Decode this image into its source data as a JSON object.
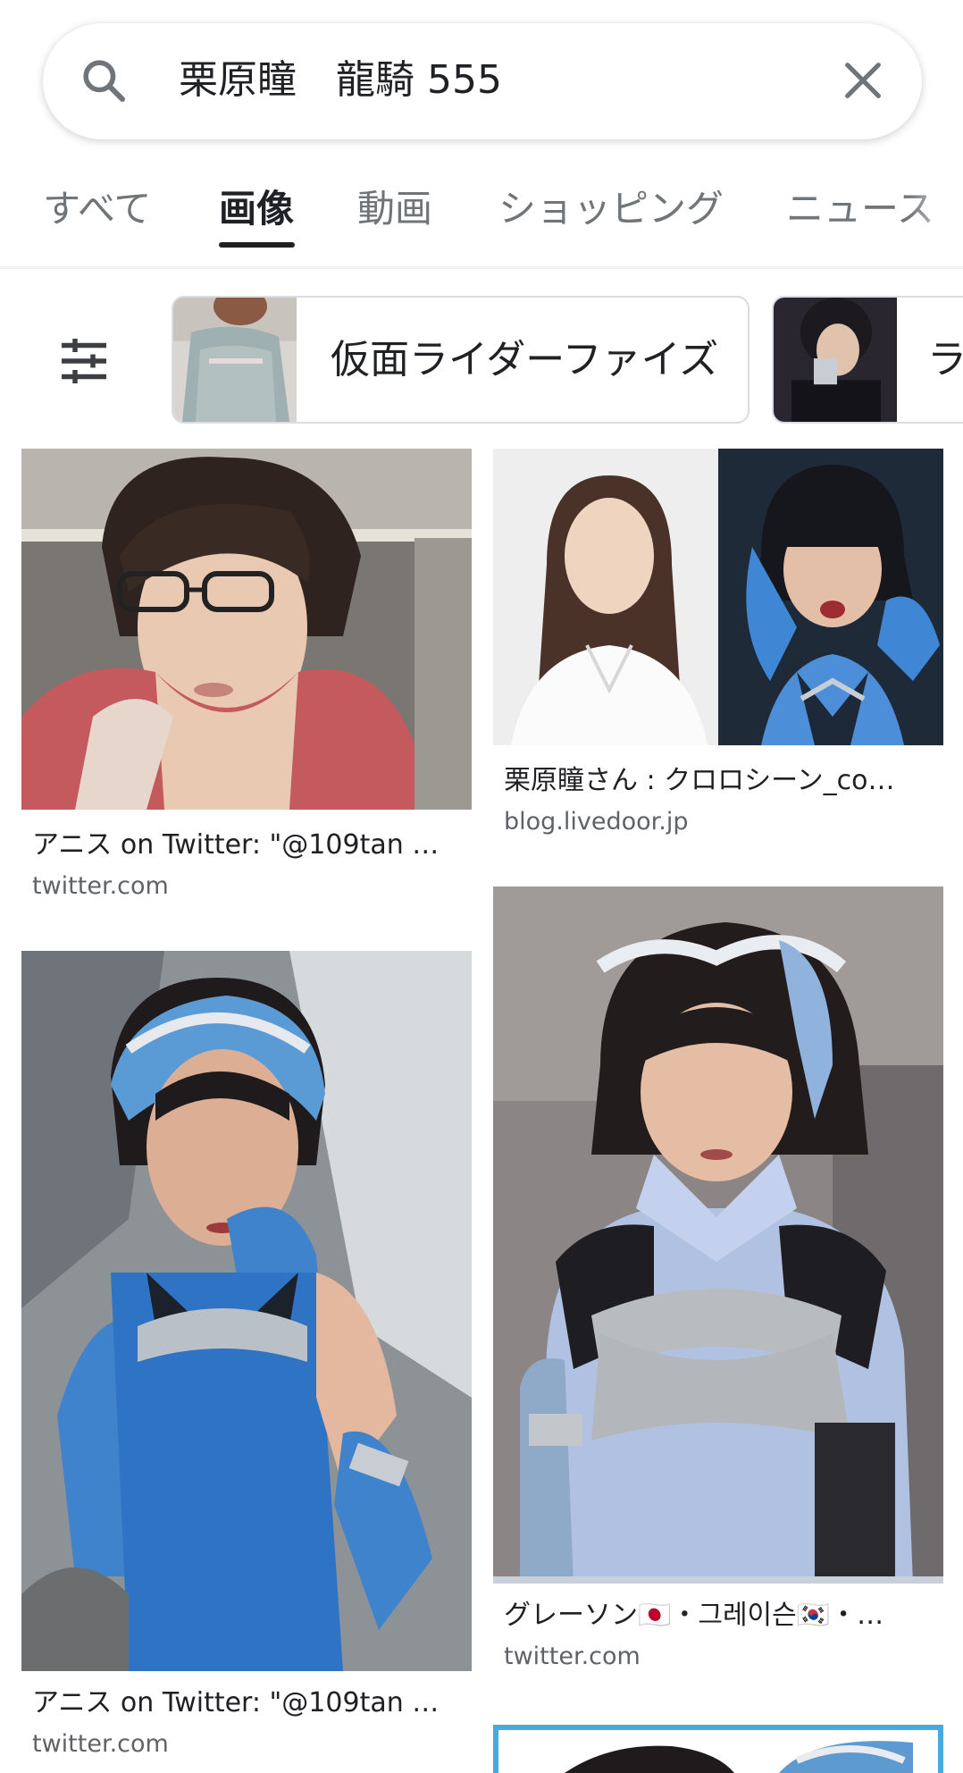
{
  "search": {
    "query": "栗原瞳　龍騎 555"
  },
  "tabs": [
    {
      "label": "すべて"
    },
    {
      "label": "画像"
    },
    {
      "label": "動画"
    },
    {
      "label": "ショッピング"
    },
    {
      "label": "ニュース"
    }
  ],
  "chips": [
    {
      "label": "仮面ライダーファイズ"
    },
    {
      "label": "ラ"
    }
  ],
  "results": [
    {
      "title": "アニス on Twitter: \"@109tan …",
      "source": "twitter.com"
    },
    {
      "title": "栗原瞳さん : クロロシーン_co…",
      "source": "blog.livedoor.jp"
    },
    {
      "title": "アニス on Twitter: \"@109tan …",
      "source": "twitter.com"
    },
    {
      "title": "グレーソン🇯🇵・그레이슨🇰🇷・…",
      "source": "twitter.com"
    }
  ],
  "colors": {
    "accent": "#202124",
    "muted": "#70757a",
    "chip_border": "#dadce0"
  }
}
